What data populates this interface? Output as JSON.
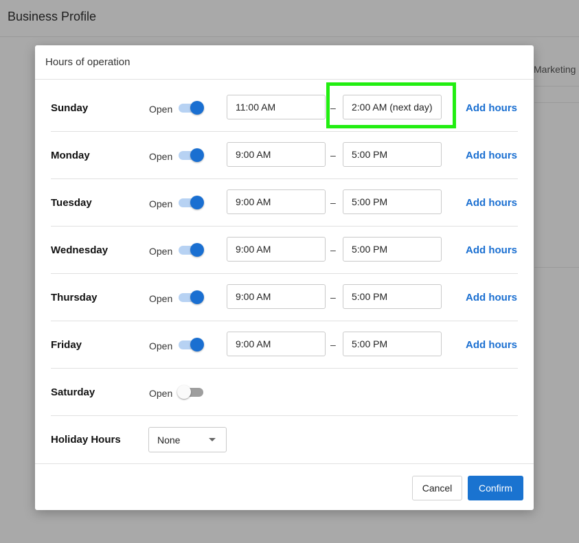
{
  "background": {
    "title": "Business Profile",
    "tab_partial": "Marketing"
  },
  "dialog": {
    "title": "Hours of operation",
    "open_label": "Open",
    "dash": "–",
    "add_hours_label": "Add hours",
    "days": [
      {
        "name": "Sunday",
        "open": true,
        "from": "11:00 AM",
        "to": "2:00 AM (next day)"
      },
      {
        "name": "Monday",
        "open": true,
        "from": "9:00 AM",
        "to": "5:00 PM"
      },
      {
        "name": "Tuesday",
        "open": true,
        "from": "9:00 AM",
        "to": "5:00 PM"
      },
      {
        "name": "Wednesday",
        "open": true,
        "from": "9:00 AM",
        "to": "5:00 PM"
      },
      {
        "name": "Thursday",
        "open": true,
        "from": "9:00 AM",
        "to": "5:00 PM"
      },
      {
        "name": "Friday",
        "open": true,
        "from": "9:00 AM",
        "to": "5:00 PM"
      },
      {
        "name": "Saturday",
        "open": false
      }
    ],
    "holiday": {
      "label": "Holiday Hours",
      "value": "None"
    },
    "cancel_label": "Cancel",
    "confirm_label": "Confirm"
  },
  "colors": {
    "accent": "#1a6fd1",
    "highlight": "#22ee11",
    "overlay": "#a9a9a9"
  }
}
